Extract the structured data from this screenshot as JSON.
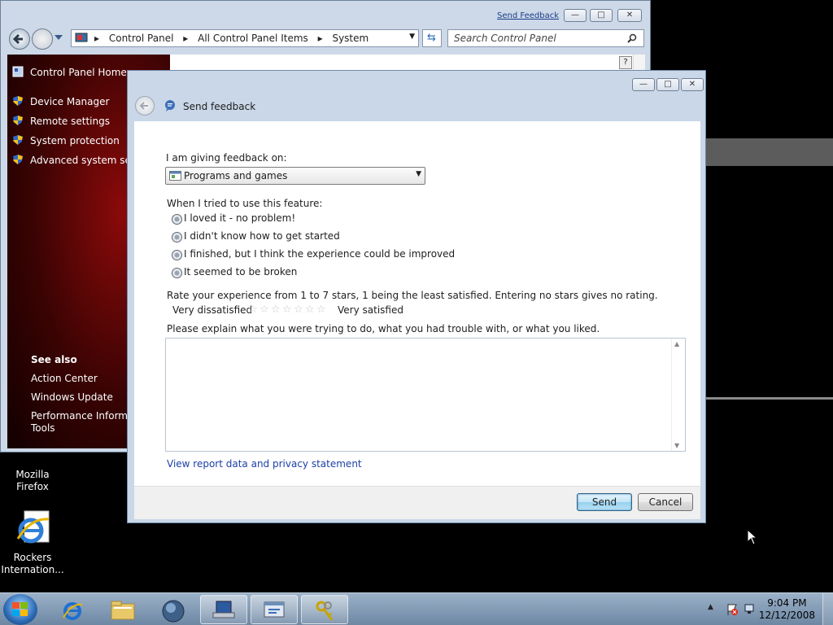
{
  "desktop": {
    "icons": [
      {
        "label": "Mozilla\nFirefox"
      },
      {
        "label": "Rockers\nInternation..."
      }
    ]
  },
  "control_panel": {
    "feedback_link": "Send Feedback",
    "breadcrumbs": [
      "Control Panel",
      "All Control Panel Items",
      "System"
    ],
    "search_placeholder": "Search Control Panel",
    "sidebar": {
      "home": "Control Panel Home",
      "items": [
        "Device Manager",
        "Remote settings",
        "System protection",
        "Advanced system setti"
      ],
      "see_also_heading": "See also",
      "see_also": [
        "Action Center",
        "Windows Update",
        "Performance Informati",
        "Tools"
      ]
    }
  },
  "dialog": {
    "title": "Send feedback",
    "giving_feedback_label": "I am giving feedback on:",
    "feedback_topic": "Programs and games",
    "feature_label": "When I tried to use this feature:",
    "options": [
      "I loved it - no problem!",
      "I didn't know how to get started",
      "I finished, but I think the experience could be improved",
      "It seemed to be broken"
    ],
    "rating_instruction": "Rate your experience from 1 to 7 stars, 1 being the least satisfied.  Entering no stars gives no rating.",
    "rating_low": "Very dissatisfied",
    "rating_high": "Very satisfied",
    "rating_value": 0,
    "rating_max": 7,
    "explain_label": "Please explain what you were trying to do, what you had trouble with, or what you liked.",
    "explain_value": "",
    "privacy_link": "View report data and privacy statement",
    "send": "Send",
    "cancel": "Cancel"
  },
  "taskbar": {
    "time": "9:04 PM",
    "date": "12/12/2008"
  },
  "colors": {
    "sidebar_red": "#8b0a0a",
    "link_blue": "#1c3fa8",
    "desktop": "#000000"
  }
}
